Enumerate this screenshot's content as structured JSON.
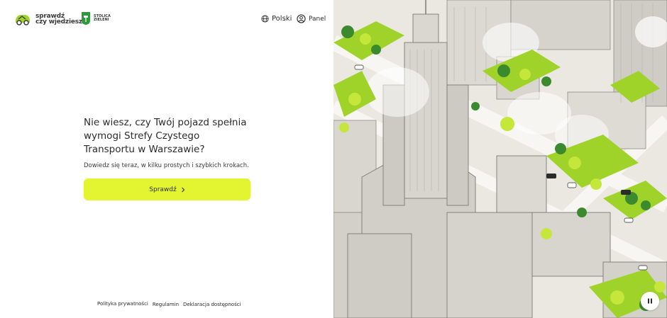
{
  "header": {
    "logo_line1": "sprawdź",
    "logo_line2": "czy wjedziesz",
    "partner_line1": "STOLICA",
    "partner_line2": "ZIELENI",
    "language_label": "Polski",
    "panel_label": "Panel"
  },
  "hero": {
    "title": "Nie wiesz, czy Twój pojazd spełnia wymogi Strefy Czystego Transportu w Warszawie?",
    "subtitle": "Dowiedz się teraz, w kilku prostych i szybkich krokach.",
    "cta_label": "Sprawdź",
    "cta_icon": "chevron-right-icon"
  },
  "footer": {
    "links": [
      "Polityka prywatności",
      "Regulamin",
      "Deklaracja dostępności"
    ]
  },
  "illustration": {
    "pause_icon": "pause-icon"
  },
  "colors": {
    "accent": "#E3F531",
    "text": "#2B2B2B",
    "green": "#9FD32A",
    "dark_green": "#3C8A2E"
  }
}
